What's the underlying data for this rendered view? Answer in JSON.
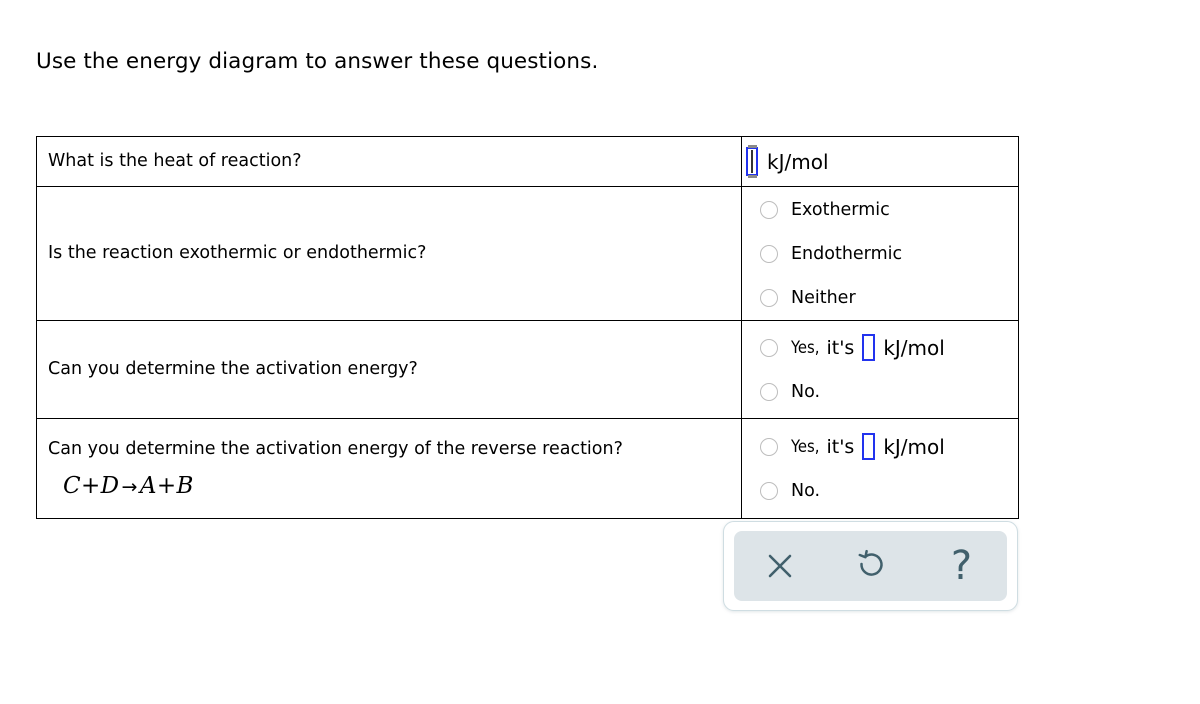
{
  "prompt": "Use the energy diagram to answer these questions.",
  "colors": {
    "input_border": "#2233ee",
    "radio_border": "#bdbdbd",
    "toolbar_panel": "#dde4e8",
    "toolbar_icon": "#41606c",
    "table_border": "#000000"
  },
  "table": {
    "rows": [
      {
        "question": "What is the heat of reaction?",
        "answer_type": "numeric-entry",
        "input_value": "",
        "unit": "kJ/mol"
      },
      {
        "question": "Is the reaction exothermic or endothermic?",
        "answer_type": "radio-group",
        "options": [
          {
            "label": "Exothermic",
            "selected": false
          },
          {
            "label": "Endothermic",
            "selected": false
          },
          {
            "label": "Neither",
            "selected": false
          }
        ]
      },
      {
        "question": "Can you determine the activation energy?",
        "answer_type": "radio-group-with-entry",
        "options": [
          {
            "label": "Yes,",
            "its_label": "it's",
            "input_value": "",
            "unit": "kJ/mol",
            "selected": false
          },
          {
            "label": "No.",
            "selected": false
          }
        ]
      },
      {
        "question": "Can you determine the activation energy of the reverse reaction?",
        "equation": {
          "reactant_1": "C",
          "plus_1": "+",
          "reactant_2": "D",
          "arrow": "→",
          "product_1": "A",
          "plus_2": "+",
          "product_2": "B"
        },
        "answer_type": "radio-group-with-entry",
        "options": [
          {
            "label": "Yes,",
            "its_label": "it's",
            "input_value": "",
            "unit": "kJ/mol",
            "selected": false
          },
          {
            "label": "No.",
            "selected": false
          }
        ]
      }
    ]
  },
  "toolbar": {
    "buttons": [
      {
        "icon": "close-icon",
        "label": "×"
      },
      {
        "icon": "undo-refresh-icon",
        "label": "↺"
      },
      {
        "icon": "help-icon",
        "label": "?"
      }
    ]
  }
}
